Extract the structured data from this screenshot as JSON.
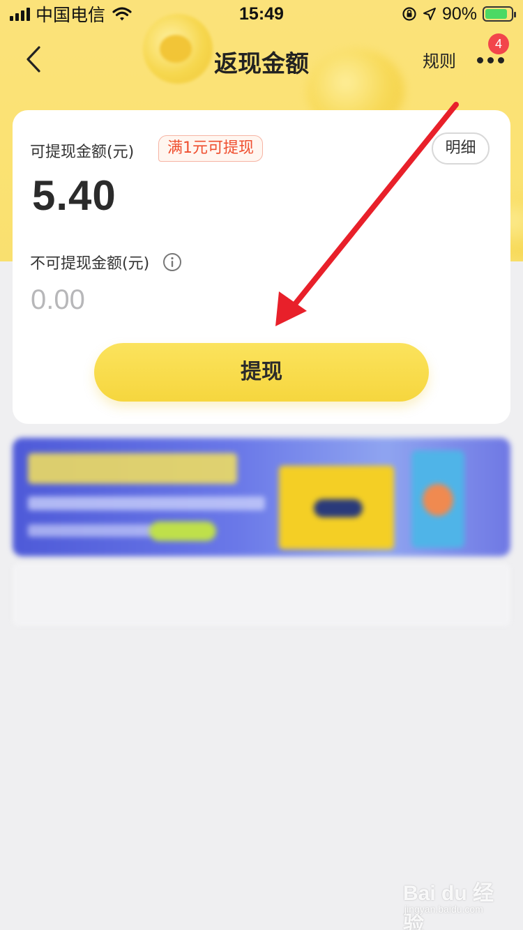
{
  "status_bar": {
    "carrier": "中国电信",
    "time": "15:49",
    "battery_percent": "90%",
    "icons": [
      "signal-icon",
      "wifi-icon",
      "orientation-lock-icon",
      "location-icon",
      "battery-charging-icon"
    ]
  },
  "nav": {
    "title": "返现金额",
    "rules_label": "规则",
    "more_badge": "4",
    "icons": [
      "back-chevron-icon",
      "more-dots-icon"
    ]
  },
  "card": {
    "available_label": "可提现金额(元)",
    "min_tag": "满1元可提现",
    "detail_label": "明细",
    "available_amount": "5.40",
    "unavailable_label": "不可提现金额(元)",
    "unavailable_amount": "0.00",
    "withdraw_label": "提现"
  },
  "watermark": {
    "brand": "Bai du 经验",
    "sub": "jingyan.baidu.com"
  },
  "colors": {
    "header_yellow": "#fbe27a",
    "button_yellow": "#f6d63e",
    "tag_red": "#ef4f2f",
    "badge_red": "#f2454b",
    "arrow_red": "#e8202a",
    "banner_blue": "#5b67de"
  }
}
